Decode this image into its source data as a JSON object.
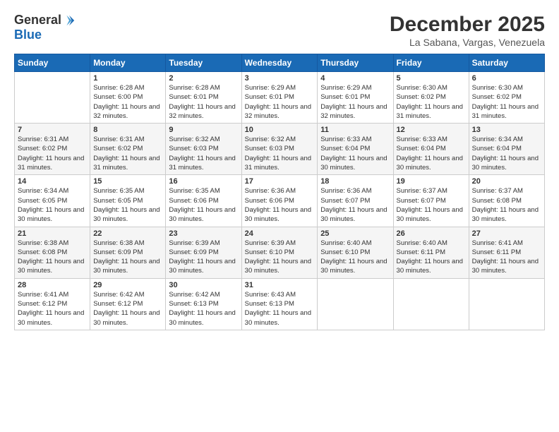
{
  "logo": {
    "general": "General",
    "blue": "Blue"
  },
  "title": "December 2025",
  "subtitle": "La Sabana, Vargas, Venezuela",
  "days_header": [
    "Sunday",
    "Monday",
    "Tuesday",
    "Wednesday",
    "Thursday",
    "Friday",
    "Saturday"
  ],
  "weeks": [
    [
      {
        "day": "",
        "sunrise": "",
        "sunset": "",
        "daylight": ""
      },
      {
        "day": "1",
        "sunrise": "Sunrise: 6:28 AM",
        "sunset": "Sunset: 6:00 PM",
        "daylight": "Daylight: 11 hours and 32 minutes."
      },
      {
        "day": "2",
        "sunrise": "Sunrise: 6:28 AM",
        "sunset": "Sunset: 6:01 PM",
        "daylight": "Daylight: 11 hours and 32 minutes."
      },
      {
        "day": "3",
        "sunrise": "Sunrise: 6:29 AM",
        "sunset": "Sunset: 6:01 PM",
        "daylight": "Daylight: 11 hours and 32 minutes."
      },
      {
        "day": "4",
        "sunrise": "Sunrise: 6:29 AM",
        "sunset": "Sunset: 6:01 PM",
        "daylight": "Daylight: 11 hours and 32 minutes."
      },
      {
        "day": "5",
        "sunrise": "Sunrise: 6:30 AM",
        "sunset": "Sunset: 6:02 PM",
        "daylight": "Daylight: 11 hours and 31 minutes."
      },
      {
        "day": "6",
        "sunrise": "Sunrise: 6:30 AM",
        "sunset": "Sunset: 6:02 PM",
        "daylight": "Daylight: 11 hours and 31 minutes."
      }
    ],
    [
      {
        "day": "7",
        "sunrise": "Sunrise: 6:31 AM",
        "sunset": "Sunset: 6:02 PM",
        "daylight": "Daylight: 11 hours and 31 minutes."
      },
      {
        "day": "8",
        "sunrise": "Sunrise: 6:31 AM",
        "sunset": "Sunset: 6:02 PM",
        "daylight": "Daylight: 11 hours and 31 minutes."
      },
      {
        "day": "9",
        "sunrise": "Sunrise: 6:32 AM",
        "sunset": "Sunset: 6:03 PM",
        "daylight": "Daylight: 11 hours and 31 minutes."
      },
      {
        "day": "10",
        "sunrise": "Sunrise: 6:32 AM",
        "sunset": "Sunset: 6:03 PM",
        "daylight": "Daylight: 11 hours and 31 minutes."
      },
      {
        "day": "11",
        "sunrise": "Sunrise: 6:33 AM",
        "sunset": "Sunset: 6:04 PM",
        "daylight": "Daylight: 11 hours and 30 minutes."
      },
      {
        "day": "12",
        "sunrise": "Sunrise: 6:33 AM",
        "sunset": "Sunset: 6:04 PM",
        "daylight": "Daylight: 11 hours and 30 minutes."
      },
      {
        "day": "13",
        "sunrise": "Sunrise: 6:34 AM",
        "sunset": "Sunset: 6:04 PM",
        "daylight": "Daylight: 11 hours and 30 minutes."
      }
    ],
    [
      {
        "day": "14",
        "sunrise": "Sunrise: 6:34 AM",
        "sunset": "Sunset: 6:05 PM",
        "daylight": "Daylight: 11 hours and 30 minutes."
      },
      {
        "day": "15",
        "sunrise": "Sunrise: 6:35 AM",
        "sunset": "Sunset: 6:05 PM",
        "daylight": "Daylight: 11 hours and 30 minutes."
      },
      {
        "day": "16",
        "sunrise": "Sunrise: 6:35 AM",
        "sunset": "Sunset: 6:06 PM",
        "daylight": "Daylight: 11 hours and 30 minutes."
      },
      {
        "day": "17",
        "sunrise": "Sunrise: 6:36 AM",
        "sunset": "Sunset: 6:06 PM",
        "daylight": "Daylight: 11 hours and 30 minutes."
      },
      {
        "day": "18",
        "sunrise": "Sunrise: 6:36 AM",
        "sunset": "Sunset: 6:07 PM",
        "daylight": "Daylight: 11 hours and 30 minutes."
      },
      {
        "day": "19",
        "sunrise": "Sunrise: 6:37 AM",
        "sunset": "Sunset: 6:07 PM",
        "daylight": "Daylight: 11 hours and 30 minutes."
      },
      {
        "day": "20",
        "sunrise": "Sunrise: 6:37 AM",
        "sunset": "Sunset: 6:08 PM",
        "daylight": "Daylight: 11 hours and 30 minutes."
      }
    ],
    [
      {
        "day": "21",
        "sunrise": "Sunrise: 6:38 AM",
        "sunset": "Sunset: 6:08 PM",
        "daylight": "Daylight: 11 hours and 30 minutes."
      },
      {
        "day": "22",
        "sunrise": "Sunrise: 6:38 AM",
        "sunset": "Sunset: 6:09 PM",
        "daylight": "Daylight: 11 hours and 30 minutes."
      },
      {
        "day": "23",
        "sunrise": "Sunrise: 6:39 AM",
        "sunset": "Sunset: 6:09 PM",
        "daylight": "Daylight: 11 hours and 30 minutes."
      },
      {
        "day": "24",
        "sunrise": "Sunrise: 6:39 AM",
        "sunset": "Sunset: 6:10 PM",
        "daylight": "Daylight: 11 hours and 30 minutes."
      },
      {
        "day": "25",
        "sunrise": "Sunrise: 6:40 AM",
        "sunset": "Sunset: 6:10 PM",
        "daylight": "Daylight: 11 hours and 30 minutes."
      },
      {
        "day": "26",
        "sunrise": "Sunrise: 6:40 AM",
        "sunset": "Sunset: 6:11 PM",
        "daylight": "Daylight: 11 hours and 30 minutes."
      },
      {
        "day": "27",
        "sunrise": "Sunrise: 6:41 AM",
        "sunset": "Sunset: 6:11 PM",
        "daylight": "Daylight: 11 hours and 30 minutes."
      }
    ],
    [
      {
        "day": "28",
        "sunrise": "Sunrise: 6:41 AM",
        "sunset": "Sunset: 6:12 PM",
        "daylight": "Daylight: 11 hours and 30 minutes."
      },
      {
        "day": "29",
        "sunrise": "Sunrise: 6:42 AM",
        "sunset": "Sunset: 6:12 PM",
        "daylight": "Daylight: 11 hours and 30 minutes."
      },
      {
        "day": "30",
        "sunrise": "Sunrise: 6:42 AM",
        "sunset": "Sunset: 6:13 PM",
        "daylight": "Daylight: 11 hours and 30 minutes."
      },
      {
        "day": "31",
        "sunrise": "Sunrise: 6:43 AM",
        "sunset": "Sunset: 6:13 PM",
        "daylight": "Daylight: 11 hours and 30 minutes."
      },
      {
        "day": "",
        "sunrise": "",
        "sunset": "",
        "daylight": ""
      },
      {
        "day": "",
        "sunrise": "",
        "sunset": "",
        "daylight": ""
      },
      {
        "day": "",
        "sunrise": "",
        "sunset": "",
        "daylight": ""
      }
    ]
  ]
}
